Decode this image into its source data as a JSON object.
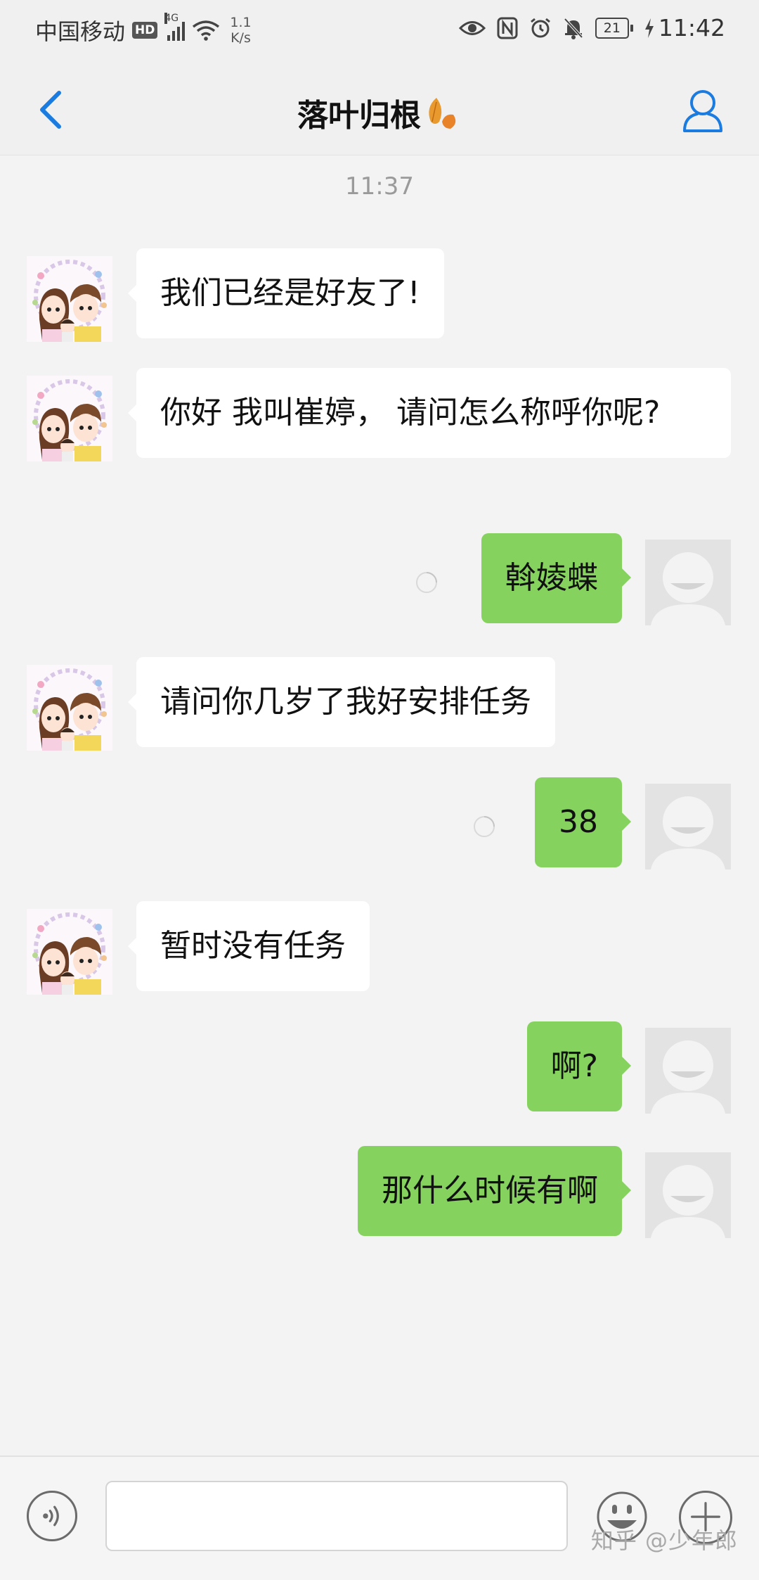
{
  "status_bar": {
    "carrier": "中国移动",
    "hd": "HD",
    "network": "4G",
    "net_speed_value": "1.1",
    "net_speed_unit": "K/s",
    "battery": "21",
    "time": "11:42"
  },
  "header": {
    "title": "落叶归根",
    "back_icon": "chevron-left-icon",
    "profile_icon": "person-icon",
    "accent_color": "#1a7be0"
  },
  "chat": {
    "timestamp": "11:37",
    "messages": [
      {
        "sender": "friend",
        "text": "我们已经是好友了!"
      },
      {
        "sender": "friend",
        "text": "你好 我叫崔婷， 请问怎么称呼你呢?"
      },
      {
        "sender": "me",
        "text": "斡婈蝶"
      },
      {
        "sender": "friend",
        "text": "请问你几岁了我好安排任务"
      },
      {
        "sender": "me",
        "text": "38"
      },
      {
        "sender": "friend",
        "text": "暂时没有任务"
      },
      {
        "sender": "me",
        "text": "啊?"
      },
      {
        "sender": "me",
        "text": "那什么时候有啊"
      }
    ],
    "my_bubble_color": "#86d25e",
    "friend_bubble_color": "#ffffff"
  },
  "input_bar": {
    "voice_icon": "voice-icon",
    "input_value": "",
    "emoji_icon": "emoji-icon",
    "plus_icon": "plus-icon"
  },
  "watermark": "知乎 @少年郎"
}
